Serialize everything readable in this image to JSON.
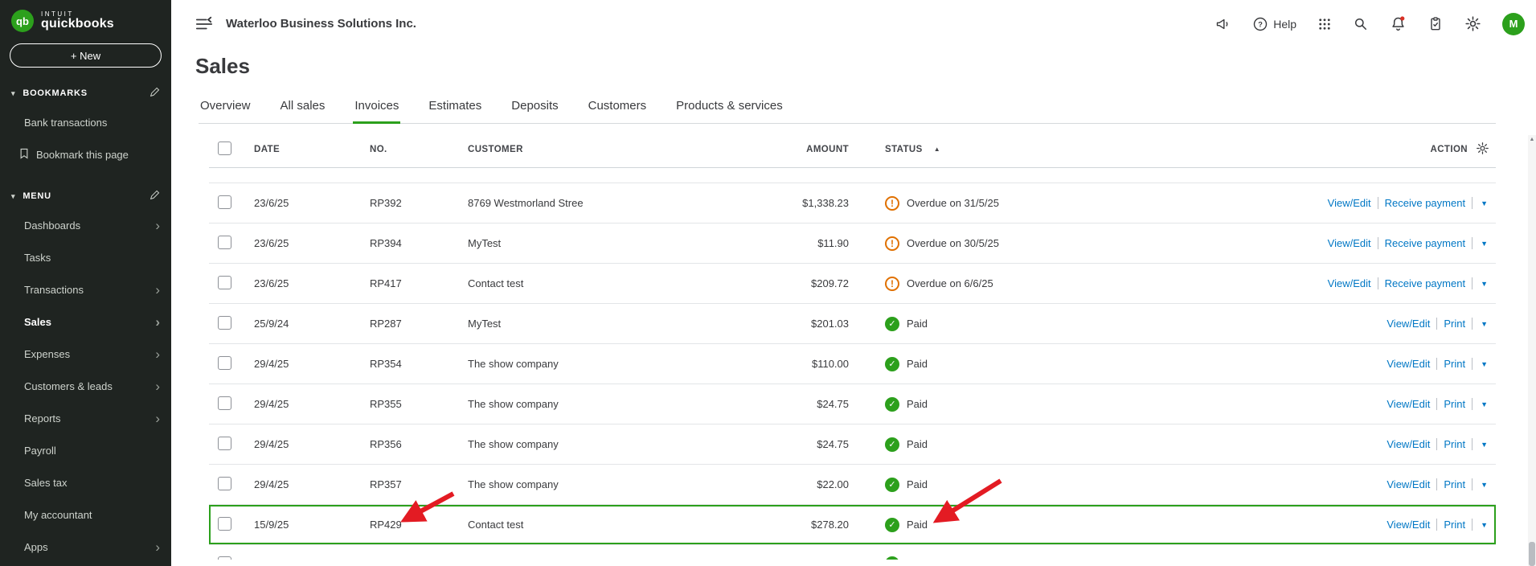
{
  "sidebar": {
    "logo": {
      "badge": "qb",
      "intuit": "INTUIT",
      "quickbooks": "quickbooks"
    },
    "new_button_label": "+ New",
    "bookmarks": {
      "label": "BOOKMARKS",
      "items": [
        {
          "label": "Bank transactions"
        },
        {
          "label": "Bookmark this page"
        }
      ]
    },
    "menu": {
      "label": "MENU",
      "items": [
        {
          "label": "Dashboards"
        },
        {
          "label": "Tasks"
        },
        {
          "label": "Transactions"
        },
        {
          "label": "Sales"
        },
        {
          "label": "Expenses"
        },
        {
          "label": "Customers & leads"
        },
        {
          "label": "Reports"
        },
        {
          "label": "Payroll"
        },
        {
          "label": "Sales tax"
        },
        {
          "label": "My accountant"
        },
        {
          "label": "Apps"
        }
      ]
    }
  },
  "header": {
    "company_name": "Waterloo Business Solutions Inc.",
    "help_label": "Help",
    "avatar_initial": "M"
  },
  "page": {
    "title": "Sales",
    "tabs": [
      {
        "label": "Overview"
      },
      {
        "label": "All sales"
      },
      {
        "label": "Invoices"
      },
      {
        "label": "Estimates"
      },
      {
        "label": "Deposits"
      },
      {
        "label": "Customers"
      },
      {
        "label": "Products & services"
      }
    ],
    "active_tab": "Invoices"
  },
  "table": {
    "columns": [
      "DATE",
      "NO.",
      "CUSTOMER",
      "AMOUNT",
      "STATUS",
      "ACTION"
    ],
    "sort_column": "STATUS",
    "sort_indicator": "▲",
    "rows": [
      {
        "date": "23/6/25",
        "no": "RP392",
        "customer": "8769 Westmorland Stree",
        "amount": "$1,338.23",
        "status": "Overdue on 31/5/25",
        "status_type": "overdue",
        "actions": [
          "View/Edit",
          "Receive payment"
        ]
      },
      {
        "date": "23/6/25",
        "no": "RP394",
        "customer": "MyTest",
        "amount": "$11.90",
        "status": "Overdue on 30/5/25",
        "status_type": "overdue",
        "actions": [
          "View/Edit",
          "Receive payment"
        ]
      },
      {
        "date": "23/6/25",
        "no": "RP417",
        "customer": "Contact test",
        "amount": "$209.72",
        "status": "Overdue on 6/6/25",
        "status_type": "overdue",
        "actions": [
          "View/Edit",
          "Receive payment"
        ]
      },
      {
        "date": "25/9/24",
        "no": "RP287",
        "customer": "MyTest",
        "amount": "$201.03",
        "status": "Paid",
        "status_type": "paid",
        "actions": [
          "View/Edit",
          "Print"
        ]
      },
      {
        "date": "29/4/25",
        "no": "RP354",
        "customer": "The show company",
        "amount": "$110.00",
        "status": "Paid",
        "status_type": "paid",
        "actions": [
          "View/Edit",
          "Print"
        ]
      },
      {
        "date": "29/4/25",
        "no": "RP355",
        "customer": "The show company",
        "amount": "$24.75",
        "status": "Paid",
        "status_type": "paid",
        "actions": [
          "View/Edit",
          "Print"
        ]
      },
      {
        "date": "29/4/25",
        "no": "RP356",
        "customer": "The show company",
        "amount": "$24.75",
        "status": "Paid",
        "status_type": "paid",
        "actions": [
          "View/Edit",
          "Print"
        ]
      },
      {
        "date": "29/4/25",
        "no": "RP357",
        "customer": "The show company",
        "amount": "$22.00",
        "status": "Paid",
        "status_type": "paid",
        "actions": [
          "View/Edit",
          "Print"
        ]
      },
      {
        "date": "15/9/25",
        "no": "RP429",
        "customer": "Contact test",
        "amount": "$278.20",
        "status": "Paid",
        "status_type": "paid",
        "actions": [
          "View/Edit",
          "Print"
        ],
        "highlighted": true
      }
    ]
  },
  "colors": {
    "brand_green": "#2CA01C",
    "link_blue": "#0077C5",
    "overdue_orange": "#E07000",
    "annotation_red": "#E31B23",
    "sidebar_bg": "#1F2421"
  }
}
